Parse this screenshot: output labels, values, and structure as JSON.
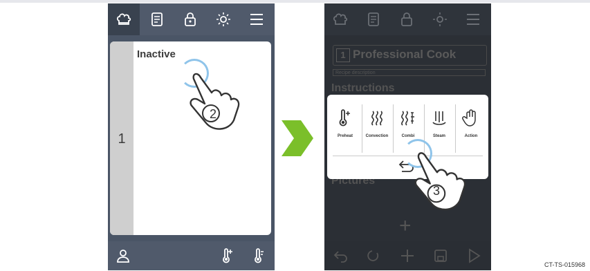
{
  "left_phone": {
    "topbar_icons": [
      "chef-hat-icon",
      "recipe-list-icon",
      "lock-icon",
      "brightness-icon",
      "menu-icon"
    ],
    "card": {
      "step_number": "1",
      "title": "Inactive"
    },
    "bottombar_icons": [
      "user-icon",
      "thermometer-add-icon",
      "thermometer-icon"
    ]
  },
  "step_markers": {
    "first": "2",
    "second": "3"
  },
  "right_phone": {
    "topbar_icons": [
      "chef-hat-icon",
      "recipe-list-icon",
      "lock-icon",
      "brightness-icon",
      "menu-icon"
    ],
    "program": {
      "number": "1",
      "title": "Professional Cook",
      "description": "Recipe description"
    },
    "instructions_heading": "Instructions",
    "pictures_heading": "Pictures",
    "add_symbol": "+",
    "popup": {
      "options": [
        {
          "label": "Preheat",
          "icon": "preheat-icon"
        },
        {
          "label": "Convection",
          "icon": "convection-icon"
        },
        {
          "label": "Combi",
          "icon": "combi-icon"
        },
        {
          "label": "Steam",
          "icon": "steam-icon"
        },
        {
          "label": "Action",
          "icon": "hand-action-icon"
        }
      ],
      "back_icon": "back-arrow-icon"
    },
    "bottombar_icons": [
      "undo-icon",
      "redo-icon",
      "add-icon",
      "save-icon",
      "play-icon"
    ]
  },
  "figure_id": "CT-TS-015968",
  "colors": {
    "accent_arrow": "#7bbf2a",
    "ripple": "#8fc4ea"
  }
}
